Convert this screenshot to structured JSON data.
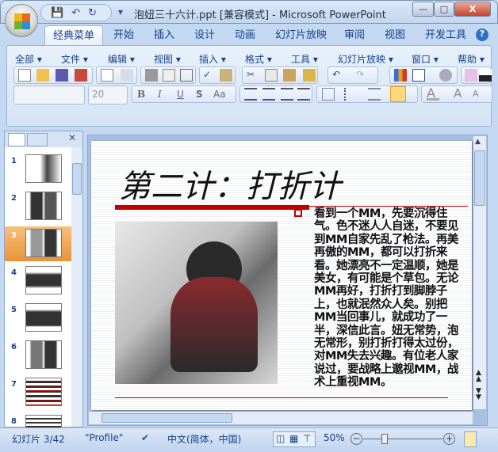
{
  "window": {
    "title": "泡妞三十六计.ppt [兼容模式] - Microsoft PowerPoint",
    "minimize": "—",
    "maximize": "□",
    "close": "X"
  },
  "qat": {
    "save": "💾",
    "undo": "↶",
    "redo": "↻",
    "more": "▾"
  },
  "tabs": [
    "经典菜单",
    "开始",
    "插入",
    "设计",
    "动画",
    "幻灯片放映",
    "审阅",
    "视图",
    "开发工具"
  ],
  "help": "?",
  "menus": [
    "全部 ▾",
    "文件 ▾",
    "编辑 ▾",
    "视图 ▾",
    "插入 ▾",
    "格式 ▾",
    "工具 ▾",
    "幻灯片放映 ▾",
    "窗口 ▾",
    "帮助 ▾"
  ],
  "format": {
    "font": "",
    "size": "20",
    "bold": "B",
    "italic": "I",
    "underline": "U",
    "shadow": "S",
    "case": "Aa"
  },
  "slides": {
    "numbers": [
      "1",
      "2",
      "3",
      "4",
      "5",
      "6",
      "7",
      "8"
    ],
    "selected": 3
  },
  "slide": {
    "title": "第二计：打折计",
    "body": "看到一个MM，先要沉得住气。色不迷人人自迷，不要见到MM自家先乱了枪法。再美再傲的MM，都可以打折来看。她漂亮不一定温顺，她是美女，有可能是个草包。无论MM再好，打折打到脚脖子上，也就泯然众人矣。别把MM当回事儿，就成功了一半，深信此言。妞无常势，泡无常形，别打折打得太过份，对MM失去兴趣。有位老人家说过，要战略上邈视MM，战术上重视MM。"
  },
  "status": {
    "slide": "幻灯片 3/42",
    "theme": "\"Profile\"",
    "language": "中文(简体，中国)",
    "zoom": "50%",
    "zoom_fraction": 0.5
  }
}
